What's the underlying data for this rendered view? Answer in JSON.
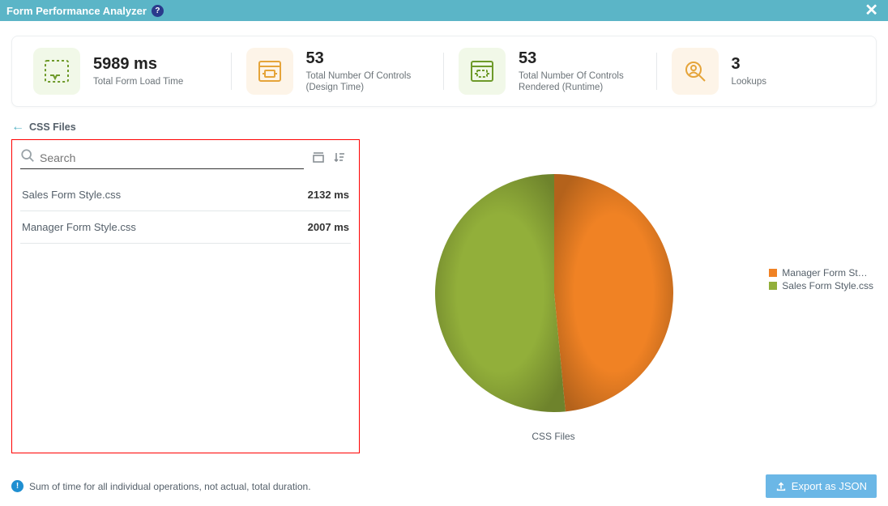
{
  "header": {
    "title": "Form Performance Analyzer",
    "help_label": "?",
    "close_label": "✕"
  },
  "metrics": [
    {
      "value": "5989 ms",
      "label": "Total Form Load Time"
    },
    {
      "value": "53",
      "label": "Total Number Of Controls (Design Time)"
    },
    {
      "value": "53",
      "label": "Total Number Of Controls Rendered (Runtime)"
    },
    {
      "value": "3",
      "label": "Lookups"
    }
  ],
  "section": {
    "back_icon": "←",
    "title": "CSS Files"
  },
  "search": {
    "placeholder": "Search"
  },
  "files": [
    {
      "name": "Sales Form Style.css",
      "time": "2132 ms"
    },
    {
      "name": "Manager Form Style.css",
      "time": "2007 ms"
    }
  ],
  "chart": {
    "title": "CSS Files",
    "legend": [
      {
        "label": "Manager Form St…",
        "color": "#f08224"
      },
      {
        "label": "Sales Form Style.css",
        "color": "#92af3a"
      }
    ]
  },
  "footer": {
    "note": "Sum of time for all individual operations, not actual, total duration.",
    "export_label": "Export as JSON"
  },
  "colors": {
    "orange": "#f08224",
    "green": "#92af3a"
  },
  "chart_data": {
    "type": "pie",
    "title": "CSS Files",
    "series": [
      {
        "name": "Manager Form Style.css",
        "value": 2007,
        "color": "#f08224"
      },
      {
        "name": "Sales Form Style.css",
        "value": 2132,
        "color": "#92af3a"
      }
    ],
    "unit": "ms"
  }
}
